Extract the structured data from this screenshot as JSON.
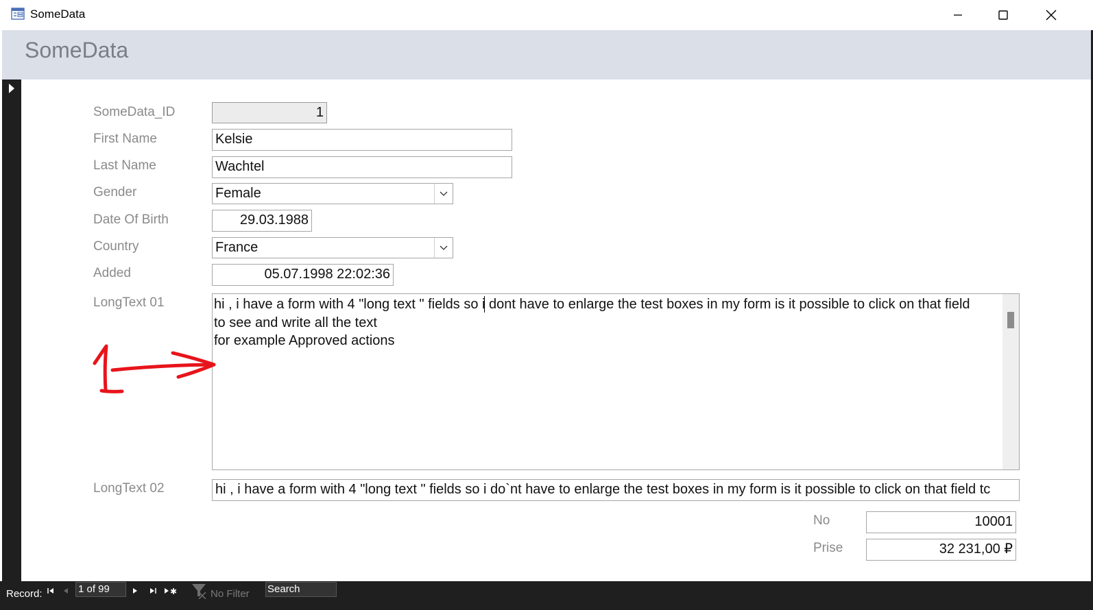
{
  "window": {
    "title": "SomeData",
    "minimize_icon": "minimize-icon",
    "maximize_icon": "maximize-icon",
    "close_icon": "close-icon"
  },
  "form": {
    "header": "SomeData",
    "fields": {
      "id": {
        "label": "SomeData_ID",
        "value": "1"
      },
      "first_name": {
        "label": "First Name",
        "value": "Kelsie"
      },
      "last_name": {
        "label": "Last Name",
        "value": "Wachtel"
      },
      "gender": {
        "label": "Gender",
        "value": "Female"
      },
      "dob": {
        "label": "Date Of Birth",
        "value": "29.03.1988"
      },
      "country": {
        "label": "Country",
        "value": "France"
      },
      "added": {
        "label": "Added",
        "value": "05.07.1998 22:02:36"
      },
      "longtext01": {
        "label": "LongText 01",
        "value": "hi , i have a form with 4 \"long text \" fields so i dont have to enlarge the test boxes in my form is it possible to click on that field\nto see and write all the text\nfor example Approved actions"
      },
      "longtext02": {
        "label": "LongText 02",
        "value": "hi , i have a form with 4 \"long text \" fields so i do`nt have to enlarge the test boxes in my form is it possible to click on that field tc"
      },
      "no": {
        "label": "No",
        "value": "10001"
      },
      "prise": {
        "label": "Prise",
        "value": "32 231,00 ₽"
      }
    }
  },
  "annotation": {
    "text": "1",
    "color": "#e8141b"
  },
  "statusbar": {
    "record_label": "Record:",
    "record_position": "1 of 99",
    "filter_label": "No Filter",
    "search_placeholder": "Search"
  }
}
